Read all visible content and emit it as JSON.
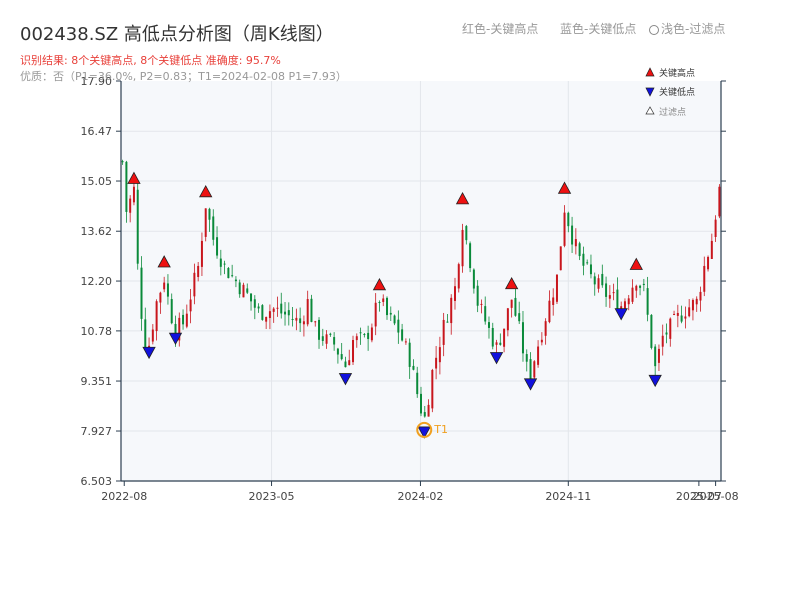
{
  "header": {
    "title": "002438.SZ 高低点分析图（周K线图）",
    "status": "识别结果: 8个关键高点, 8个关键低点  准确度: 95.7%",
    "quality": "优质：否（P1=36.0%, P2=0.83；T1=2024-02-08 P1=7.93）"
  },
  "top_legend": {
    "red": "红色-关键高点",
    "blue": "蓝色-关键低点",
    "light": "浅色-过滤点"
  },
  "colors": {
    "up": "#c8161d",
    "down": "#0a8a3a",
    "high_marker": "#ee1111",
    "low_marker": "#1111dd",
    "highlight": "#f0a020",
    "plot_bg": "#f6f8fb",
    "grid": "#e3e6eb",
    "axis": "#2c3e50"
  },
  "chart_data": {
    "type": "candlestick",
    "title": "002438.SZ 高低点分析图（周K线图）",
    "ylim": [
      6.503,
      17.9
    ],
    "y_ticks": [
      "6.503",
      "7.927",
      "9.351",
      "10.78",
      "12.20",
      "13.62",
      "15.05",
      "16.47",
      "17.90"
    ],
    "x_ticks": [
      "2022-08",
      "2023-05",
      "2024-02",
      "2024-11",
      "2025-07",
      "2025-08"
    ],
    "legend": {
      "position": "top-right",
      "entries": [
        "关键高点",
        "关键低点",
        "过滤点"
      ]
    },
    "highs": [
      {
        "date": "2022-08-19",
        "price": 14.98
      },
      {
        "date": "2022-10-14",
        "price": 12.6
      },
      {
        "date": "2022-12-30",
        "price": 14.6
      },
      {
        "date": "2023-11-17",
        "price": 11.95
      },
      {
        "date": "2024-04-19",
        "price": 14.4
      },
      {
        "date": "2024-07-19",
        "price": 11.98
      },
      {
        "date": "2024-10-25",
        "price": 14.7
      },
      {
        "date": "2025-03-07",
        "price": 12.53
      }
    ],
    "lows": [
      {
        "date": "2022-09-16",
        "price": 10.2
      },
      {
        "date": "2022-11-04",
        "price": 10.6
      },
      {
        "date": "2023-09-15",
        "price": 9.45
      },
      {
        "date": "2024-02-08",
        "price": 7.93
      },
      {
        "date": "2024-06-21",
        "price": 10.05
      },
      {
        "date": "2024-08-23",
        "price": 9.3
      },
      {
        "date": "2025-02-07",
        "price": 11.3
      },
      {
        "date": "2025-04-11",
        "price": 9.4
      }
    ],
    "annotation": {
      "label": "T1",
      "date": "2024-02-08",
      "price": 7.93
    },
    "series_shape": [
      [
        "2022-07-29",
        15.6
      ],
      [
        "2022-08-05",
        14.2
      ],
      [
        "2022-08-19",
        14.8
      ],
      [
        "2022-08-26",
        12.6
      ],
      [
        "2022-09-02",
        11.3
      ],
      [
        "2022-09-09",
        10.5
      ],
      [
        "2022-09-16",
        10.4
      ],
      [
        "2022-09-30",
        11.6
      ],
      [
        "2022-10-14",
        12.3
      ],
      [
        "2022-10-21",
        11.7
      ],
      [
        "2022-10-28",
        11.2
      ],
      [
        "2022-11-04",
        10.8
      ],
      [
        "2022-11-18",
        11.0
      ],
      [
        "2022-12-02",
        11.8
      ],
      [
        "2022-12-16",
        12.6
      ],
      [
        "2022-12-30",
        14.4
      ],
      [
        "2023-01-13",
        13.4
      ],
      [
        "2023-02-03",
        12.6
      ],
      [
        "2023-02-24",
        12.2
      ],
      [
        "2023-03-17",
        11.8
      ],
      [
        "2023-04-07",
        11.3
      ],
      [
        "2023-05-05",
        11.4
      ],
      [
        "2023-06-02",
        11.2
      ],
      [
        "2023-06-23",
        11.0
      ],
      [
        "2023-07-07",
        11.6
      ],
      [
        "2023-07-21",
        10.8
      ],
      [
        "2023-08-11",
        10.5
      ],
      [
        "2023-08-25",
        10.4
      ],
      [
        "2023-09-08",
        10.0
      ],
      [
        "2023-09-15",
        9.8
      ],
      [
        "2023-09-29",
        10.5
      ],
      [
        "2023-10-20",
        10.5
      ],
      [
        "2023-11-03",
        11.0
      ],
      [
        "2023-11-17",
        11.7
      ],
      [
        "2023-12-01",
        11.2
      ],
      [
        "2023-12-22",
        10.8
      ],
      [
        "2024-01-12",
        10.0
      ],
      [
        "2024-01-26",
        9.0
      ],
      [
        "2024-02-08",
        8.2
      ],
      [
        "2024-02-23",
        9.6
      ],
      [
        "2024-03-08",
        10.5
      ],
      [
        "2024-03-22",
        11.3
      ],
      [
        "2024-04-05",
        12.0
      ],
      [
        "2024-04-19",
        13.9
      ],
      [
        "2024-05-03",
        12.8
      ],
      [
        "2024-05-17",
        11.6
      ],
      [
        "2024-06-07",
        10.8
      ],
      [
        "2024-06-21",
        10.3
      ],
      [
        "2024-07-05",
        10.9
      ],
      [
        "2024-07-19",
        11.7
      ],
      [
        "2024-08-02",
        10.8
      ],
      [
        "2024-08-16",
        9.7
      ],
      [
        "2024-08-23",
        9.6
      ],
      [
        "2024-09-06",
        10.4
      ],
      [
        "2024-09-20",
        11.2
      ],
      [
        "2024-10-11",
        12.3
      ],
      [
        "2024-10-25",
        14.3
      ],
      [
        "2024-11-08",
        13.5
      ],
      [
        "2024-11-22",
        12.8
      ],
      [
        "2024-12-13",
        12.3
      ],
      [
        "2025-01-03",
        11.9
      ],
      [
        "2025-01-24",
        11.7
      ],
      [
        "2025-02-07",
        11.5
      ],
      [
        "2025-02-21",
        11.9
      ],
      [
        "2025-03-07",
        12.3
      ],
      [
        "2025-03-21",
        11.9
      ],
      [
        "2025-04-11",
        9.7
      ],
      [
        "2025-04-25",
        10.6
      ],
      [
        "2025-05-16",
        11.0
      ],
      [
        "2025-06-06",
        11.4
      ],
      [
        "2025-06-27",
        11.6
      ],
      [
        "2025-07-11",
        12.6
      ],
      [
        "2025-07-25",
        13.4
      ],
      [
        "2025-08-08",
        14.8
      ]
    ]
  }
}
